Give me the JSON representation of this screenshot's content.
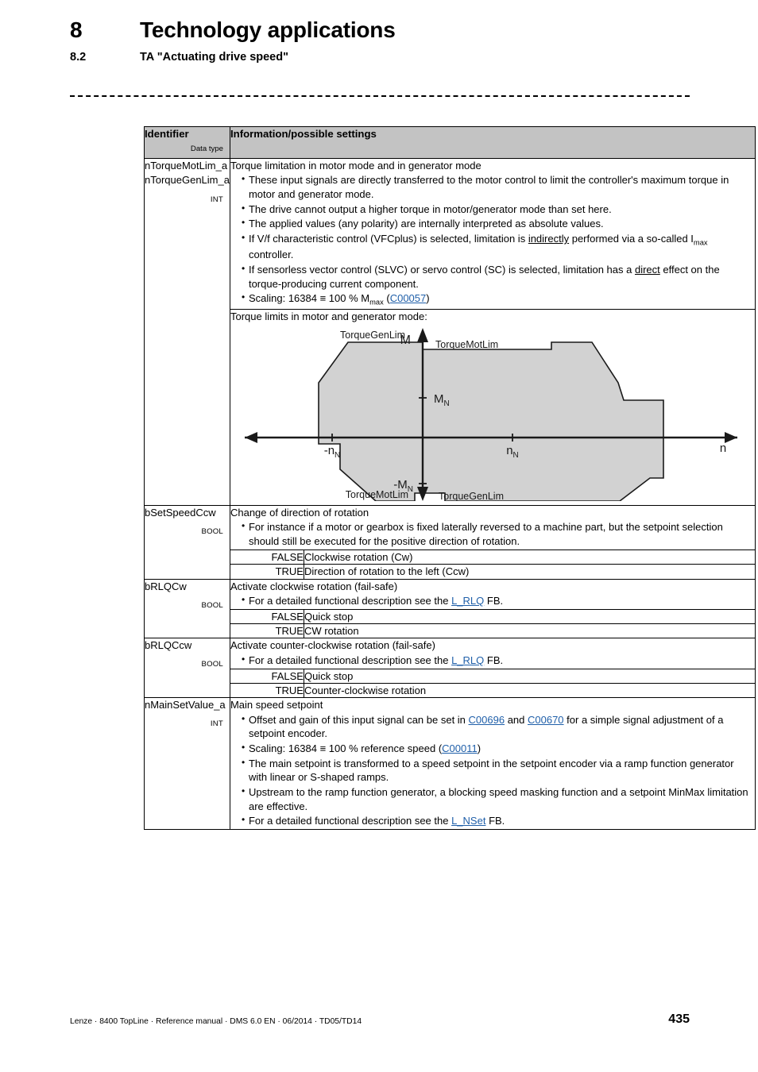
{
  "header": {
    "chapter_number": "8",
    "chapter_title": "Technology applications",
    "section_number": "8.2",
    "section_title": "TA \"Actuating drive speed\""
  },
  "table": {
    "columns": {
      "identifier": "Identifier",
      "data_type": "Data type",
      "information": "Information/possible settings"
    },
    "rows": [
      {
        "identifier_lines": [
          "nTorqueMotLim_a",
          "nTorqueGenLim_a"
        ],
        "data_type": "INT",
        "heading": "Torque limitation in motor mode and in generator mode",
        "bullets": [
          "These input signals are directly transferred to the motor control to limit the controller's maximum torque in motor and generator mode.",
          "The drive cannot output a higher torque in motor/generator mode than set here.",
          "The applied values (any polarity) are internally interpreted as absolute values.",
          "If V/f characteristic control (VFCplus) is selected, limitation is indirectly performed via a so-called Imax controller.",
          "If sensorless vector control (SLVC) or servo control (SC) is selected, limitation has a direct effect on the torque-producing current component.",
          "Scaling: 16384 ≡ 100 % Mmax (C00057)"
        ],
        "link_1": "C00057"
      },
      {
        "identifier_lines": [
          "bSetSpeedCcw"
        ],
        "data_type": "BOOL",
        "heading": "Change of direction of rotation",
        "bullets": [
          "For instance if a motor or gearbox is fixed laterally reversed to a machine part, but the setpoint selection should still be executed for the positive direction of rotation."
        ],
        "values": [
          {
            "value": "FALSE",
            "description": "Clockwise rotation (Cw)"
          },
          {
            "value": "TRUE",
            "description": "Direction of rotation to the left (Ccw)"
          }
        ]
      },
      {
        "identifier_lines": [
          "bRLQCw"
        ],
        "data_type": "BOOL",
        "heading": "Activate clockwise rotation (fail-safe)",
        "bullet_prefix": "For a detailed functional description see the ",
        "bullet_link": "L_RLQ",
        "bullet_suffix": " FB.",
        "values": [
          {
            "value": "FALSE",
            "description": "Quick stop"
          },
          {
            "value": "TRUE",
            "description": "CW rotation"
          }
        ]
      },
      {
        "identifier_lines": [
          "bRLQCcw"
        ],
        "data_type": "BOOL",
        "heading": "Activate counter-clockwise rotation (fail-safe)",
        "bullet_prefix": "For a detailed functional description see the ",
        "bullet_link": "L_RLQ",
        "bullet_suffix": " FB.",
        "values": [
          {
            "value": "FALSE",
            "description": "Quick stop"
          },
          {
            "value": "TRUE",
            "description": "Counter-clockwise rotation"
          }
        ]
      },
      {
        "identifier_lines": [
          "nMainSetValue_a"
        ],
        "data_type": "INT",
        "heading": "Main speed setpoint",
        "bullets": [
          "Offset and gain of this input signal can be set in C00696 and C00670 for a simple signal adjustment of a setpoint encoder.",
          "Scaling: 16384 ≡ 100 % reference speed (C00011)",
          "The main setpoint is transformed to a speed setpoint in the setpoint encoder via a ramp function generator with linear or S-shaped ramps.",
          "Upstream to the ramp function generator, a blocking speed masking function and a setpoint MinMax limitation are effective.",
          "For a detailed functional description see the L_NSet FB."
        ],
        "links": [
          "C00696",
          "C00670",
          "C00011",
          "L_NSet"
        ]
      }
    ]
  },
  "diagram": {
    "caption": "Torque limits in motor and generator mode:",
    "axis_x_label": "n",
    "axis_y_label": "M",
    "tick_labels": {
      "m_nominal": "MN",
      "m_nominal_neg": "-MN",
      "n_nominal": "nN",
      "n_nominal_neg": "-nN"
    },
    "region_labels": {
      "top_left": "TorqueGenLim",
      "top_right": "TorqueMotLim",
      "bottom_left": "TorqueMotLim",
      "bottom_right": "TorqueGenLim"
    },
    "fill_color": "#d2d2d2",
    "stroke_color": "#1a1a1a"
  },
  "footer": {
    "text": "Lenze · 8400 TopLine · Reference manual · DMS 6.0 EN · 06/2014 · TD05/TD14",
    "page_number": "435"
  }
}
